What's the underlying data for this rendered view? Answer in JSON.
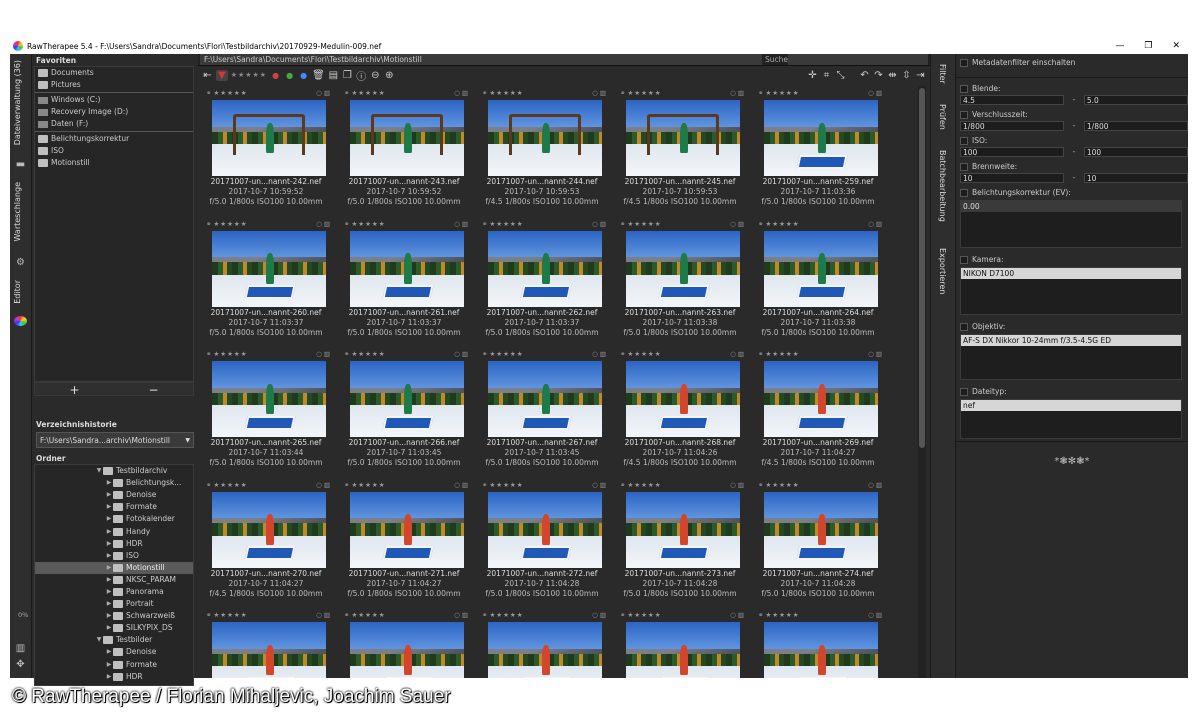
{
  "window": {
    "title": "RawTherapee 5.4 - F:\\Users\\Sandra\\Documents\\Flori\\Testbildarchiv\\20170929-Medulin-009.nef",
    "min": "—",
    "max": "❐",
    "close": "✕"
  },
  "vtabs": {
    "filebrowser": "Dateiverwaltung (36)",
    "queue": "Warteschlange",
    "editor": "Editor",
    "progress": "0%"
  },
  "places": {
    "header": "Favoriten",
    "favorites": [
      "Documents",
      "Pictures"
    ],
    "drives": [
      "Windows (C:)",
      "Recovery Image (D:)",
      "Daten (F:)"
    ],
    "recent": [
      "Belichtungskorrektur",
      "ISO",
      "Motionstill"
    ],
    "add": "+",
    "remove": "−"
  },
  "history": {
    "header": "Verzeichnishistorie",
    "value": "F:\\Users\\Sandra...archiv\\Motionstill"
  },
  "tree": {
    "header": "Ordner",
    "rows": [
      {
        "label": "Testbildarchiv",
        "level": 0,
        "open": true
      },
      {
        "label": "Belichtungsk...",
        "level": 1
      },
      {
        "label": "Denoise",
        "level": 1
      },
      {
        "label": "Formate",
        "level": 1
      },
      {
        "label": "Fotokalender",
        "level": 1
      },
      {
        "label": "Handy",
        "level": 1
      },
      {
        "label": "HDR",
        "level": 1
      },
      {
        "label": "ISO",
        "level": 1
      },
      {
        "label": "Motionstill",
        "level": 1,
        "selected": true
      },
      {
        "label": "NKSC_PARAM",
        "level": 1
      },
      {
        "label": "Panorama",
        "level": 1
      },
      {
        "label": "Portrait",
        "level": 1
      },
      {
        "label": "Schwarzweiß",
        "level": 1
      },
      {
        "label": "SILKYPIX_DS",
        "level": 1
      },
      {
        "label": "Testbilder",
        "level": 0,
        "open": true
      },
      {
        "label": "Denoise",
        "level": 1
      },
      {
        "label": "Formate",
        "level": 1
      },
      {
        "label": "HDR",
        "level": 1
      }
    ]
  },
  "browser": {
    "path": "F:\\Users\\Sandra\\Documents\\Flori\\Testbildarchiv\\Motionstill",
    "search_label": "Suche",
    "thumbs": [
      {
        "fn": "20171007-un...nannt-242.nef",
        "dt": "2017-10-7 10:59:52",
        "ex": "f/5.0 1/800s ISO100 10.00mm",
        "scene": "swing"
      },
      {
        "fn": "20171007-un...nannt-243.nef",
        "dt": "2017-10-7 10:59:52",
        "ex": "f/5.0 1/800s ISO100 10.00mm",
        "scene": "swing"
      },
      {
        "fn": "20171007-un...nannt-244.nef",
        "dt": "2017-10-7 10:59:53",
        "ex": "f/4.5 1/800s ISO100 10.00mm",
        "scene": "swing"
      },
      {
        "fn": "20171007-un...nannt-245.nef",
        "dt": "2017-10-7 10:59:53",
        "ex": "f/4.5 1/800s ISO100 10.00mm",
        "scene": "swing"
      },
      {
        "fn": "20171007-un...nannt-259.nef",
        "dt": "2017-10-7 11:03:36",
        "ex": "f/5.0 1/800s ISO100 10.00mm",
        "scene": "green"
      },
      {
        "fn": "20171007-un...nannt-260.nef",
        "dt": "2017-10-7 11:03:37",
        "ex": "f/5.0 1/800s ISO100 10.00mm",
        "scene": "green"
      },
      {
        "fn": "20171007-un...nannt-261.nef",
        "dt": "2017-10-7 11:03:37",
        "ex": "f/5.0 1/800s ISO100 10.00mm",
        "scene": "green"
      },
      {
        "fn": "20171007-un...nannt-262.nef",
        "dt": "2017-10-7 11:03:37",
        "ex": "f/5.0 1/800s ISO100 10.00mm",
        "scene": "green"
      },
      {
        "fn": "20171007-un...nannt-263.nef",
        "dt": "2017-10-7 11:03:38",
        "ex": "f/5.0 1/800s ISO100 10.00mm",
        "scene": "green"
      },
      {
        "fn": "20171007-un...nannt-264.nef",
        "dt": "2017-10-7 11:03:38",
        "ex": "f/5.0 1/800s ISO100 10.00mm",
        "scene": "green"
      },
      {
        "fn": "20171007-un...nannt-265.nef",
        "dt": "2017-10-7 11:03:44",
        "ex": "f/5.0 1/800s ISO100 10.00mm",
        "scene": "green"
      },
      {
        "fn": "20171007-un...nannt-266.nef",
        "dt": "2017-10-7 11:03:45",
        "ex": "f/5.0 1/800s ISO100 10.00mm",
        "scene": "green"
      },
      {
        "fn": "20171007-un...nannt-267.nef",
        "dt": "2017-10-7 11:03:45",
        "ex": "f/5.0 1/800s ISO100 10.00mm",
        "scene": "green"
      },
      {
        "fn": "20171007-un...nannt-268.nef",
        "dt": "2017-10-7 11:04:26",
        "ex": "f/4.5 1/800s ISO100 10.00mm",
        "scene": "red"
      },
      {
        "fn": "20171007-un...nannt-269.nef",
        "dt": "2017-10-7 11:04:27",
        "ex": "f/4.5 1/800s ISO100 10.00mm",
        "scene": "red"
      },
      {
        "fn": "20171007-un...nannt-270.nef",
        "dt": "2017-10-7 11:04:27",
        "ex": "f/4.5 1/800s ISO100 10.00mm",
        "scene": "red"
      },
      {
        "fn": "20171007-un...nannt-271.nef",
        "dt": "2017-10-7 11:04:27",
        "ex": "f/5.0 1/800s ISO100 10.00mm",
        "scene": "red"
      },
      {
        "fn": "20171007-un...nannt-272.nef",
        "dt": "2017-10-7 11:04:28",
        "ex": "f/5.0 1/800s ISO100 10.00mm",
        "scene": "red"
      },
      {
        "fn": "20171007-un...nannt-273.nef",
        "dt": "2017-10-7 11:04:28",
        "ex": "f/5.0 1/800s ISO100 10.00mm",
        "scene": "red"
      },
      {
        "fn": "20171007-un...nannt-274.nef",
        "dt": "2017-10-7 11:04:28",
        "ex": "f/5.0 1/800s ISO100 10.00mm",
        "scene": "red"
      },
      {
        "fn": "",
        "dt": "",
        "ex": "",
        "scene": "red"
      },
      {
        "fn": "",
        "dt": "",
        "ex": "",
        "scene": "red"
      },
      {
        "fn": "",
        "dt": "",
        "ex": "",
        "scene": "red"
      },
      {
        "fn": "",
        "dt": "",
        "ex": "",
        "scene": "red"
      },
      {
        "fn": "",
        "dt": "",
        "ex": "",
        "scene": "red"
      }
    ]
  },
  "sidetabs": {
    "filter": "Filter",
    "inspect": "Prüfen",
    "batch": "Batchbearbeitung",
    "export": "Exportieren"
  },
  "filter": {
    "enable": "Metadatenfilter einschalten",
    "aperture": {
      "label": "Blende:",
      "min": "4.5",
      "max": "5.0"
    },
    "shutter": {
      "label": "Verschlusszeit:",
      "min": "1/800",
      "max": "1/800"
    },
    "iso": {
      "label": "ISO:",
      "min": "100",
      "max": "100"
    },
    "focal": {
      "label": "Brennweite:",
      "min": "10",
      "max": "10"
    },
    "expcomp": {
      "label": "Belichtungskorrektur (EV):",
      "value": "0.00"
    },
    "camera": {
      "label": "Kamera:",
      "value": "NIKON D7100"
    },
    "lens": {
      "label": "Objektiv:",
      "value": "AF-S DX Nikkor 10-24mm f/3.5-4.5G ED"
    },
    "filetype": {
      "label": "Dateityp:",
      "value": "nef"
    },
    "ornament": "*❃✻❃*"
  },
  "credit": "© RawTherapee / Florian Mihaljevic, Joachim Sauer"
}
